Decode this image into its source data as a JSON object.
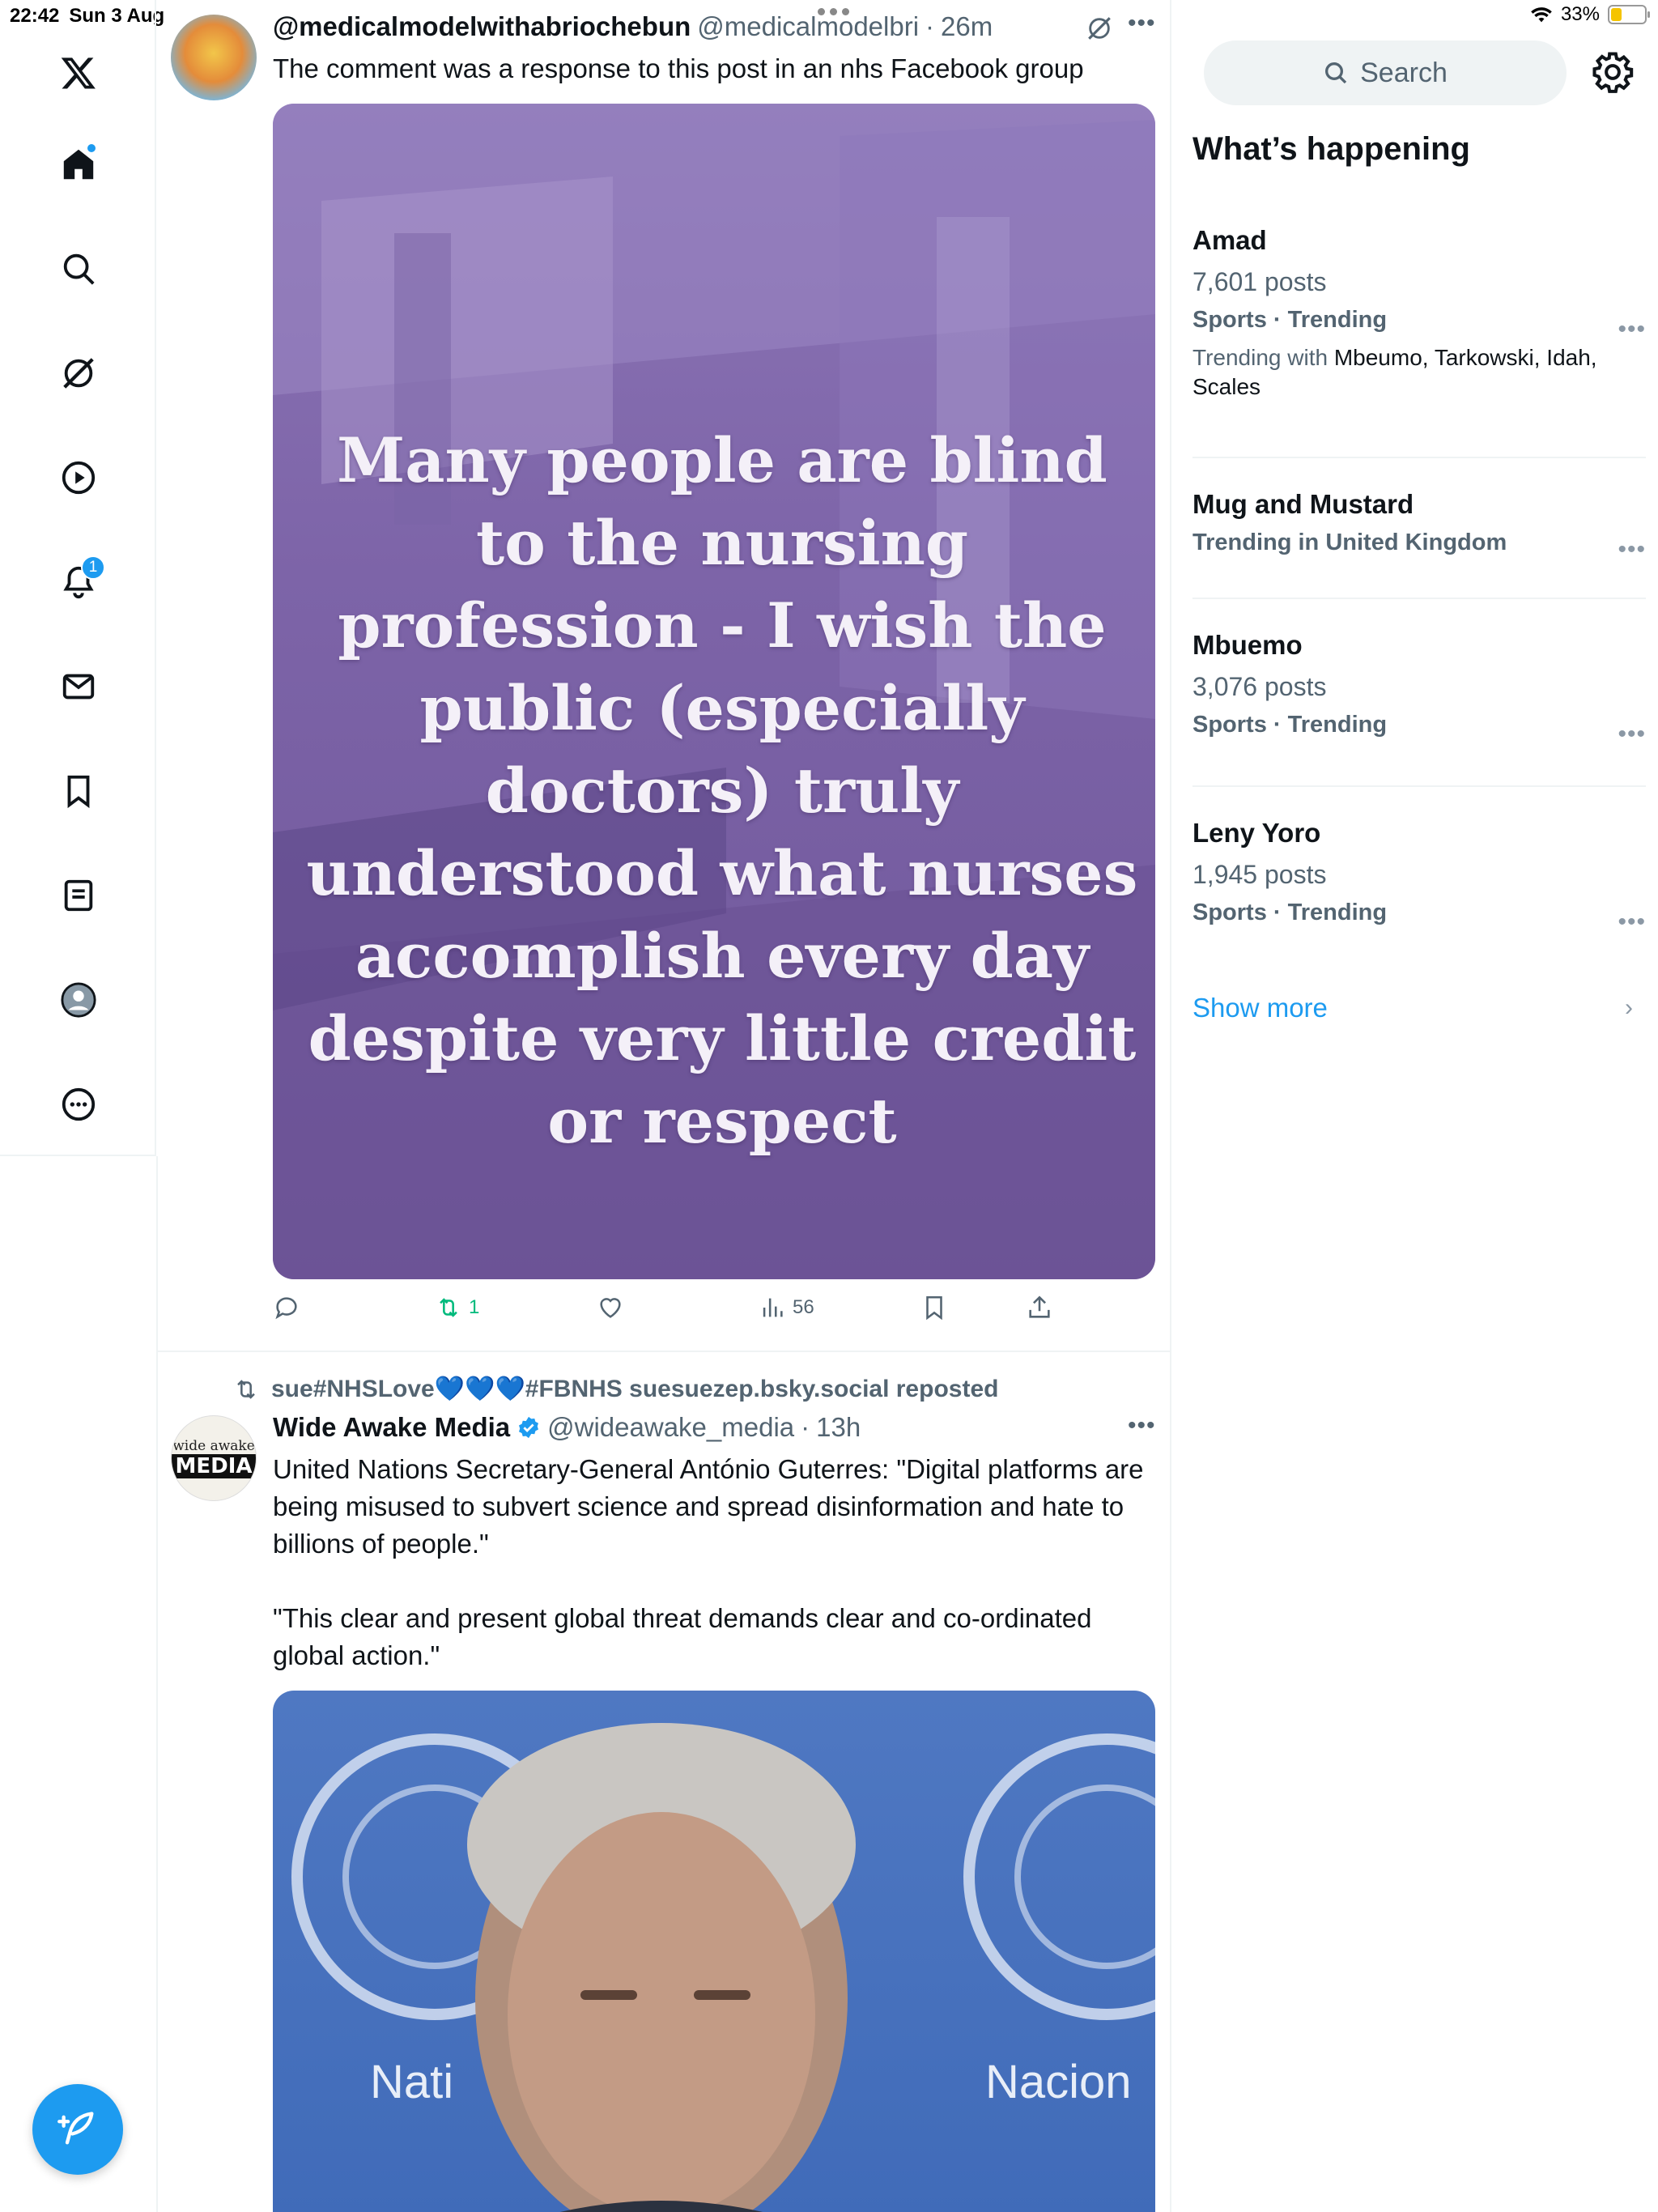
{
  "status_bar": {
    "time": "22:42",
    "date": "Sun 3 Aug",
    "battery": "33%"
  },
  "nav": {
    "notifications_count": "1"
  },
  "colors": {
    "accent": "#1d9bf0",
    "repost_green": "#00ba7c",
    "nursing_purple": "#7d64a8",
    "un_blue": "#4a73bf"
  },
  "post1": {
    "name": "@medicalmodelwithabriochebun",
    "handle": "@medicalmodelbri",
    "dot": "·",
    "time": "26m",
    "text": "The comment was a response to this post in an nhs Facebook group",
    "image_text": "Many people are blind to the nursing profession - I wish the public (especially doctors) truly understood what nurses accomplish every day despite very little credit or respect",
    "reposts": "1",
    "views": "56"
  },
  "post2": {
    "repost_by": "sue#NHSLove💙💙💙#FBNHS suesuezep.bsky.social reposted",
    "name": "Wide Awake Media",
    "handle": "@wideawake_media",
    "dot": "·",
    "time": "13h",
    "avatar_line1": "wide awake",
    "avatar_line2": "MEDIA",
    "text": "United Nations Secretary-General António Guterres: \"Digital platforms are being misused to subvert science and spread disinformation and hate to billions of people.\"\n\n\"This clear and present global threat demands clear and co-ordinated global action.\"",
    "image_text_left": "Nati",
    "image_text_right": "Nacion"
  },
  "sidebar": {
    "search_placeholder": "Search",
    "title": "What’s happening",
    "trends": [
      {
        "name": "Amad",
        "count": "7,601 posts",
        "meta": "Sports · Trending",
        "with_label": "Trending with",
        "with_names": "Mbeumo, Tarkowski, Idah, Scales"
      },
      {
        "name": "Mug and Mustard",
        "meta": "Trending in United Kingdom"
      },
      {
        "name": "Mbuemo",
        "count": "3,076 posts",
        "meta": "Sports · Trending"
      },
      {
        "name": "Leny Yoro",
        "count": "1,945 posts",
        "meta": "Sports · Trending"
      }
    ],
    "show_more": "Show more"
  }
}
